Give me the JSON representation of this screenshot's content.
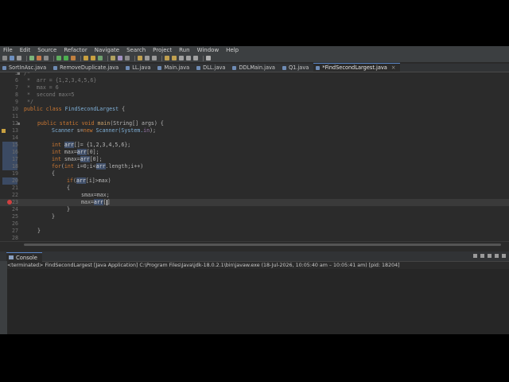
{
  "menu": [
    "File",
    "Edit",
    "Source",
    "Refactor",
    "Navigate",
    "Search",
    "Project",
    "Run",
    "Window",
    "Help"
  ],
  "tabs": [
    {
      "label": "SortInAsc.java"
    },
    {
      "label": "RemoveDuplicate.java"
    },
    {
      "label": "LL.java"
    },
    {
      "label": "Main.java"
    },
    {
      "label": "DLL.java"
    },
    {
      "label": "DDLMain.java"
    },
    {
      "label": "Q1.java"
    },
    {
      "label": "*FindSecondLargest.java",
      "active": true,
      "close": "×"
    }
  ],
  "lines": [
    "5",
    "6",
    "7",
    "8",
    "9",
    "10",
    "11",
    "12",
    "13",
    "14",
    "15",
    "16",
    "17",
    "18",
    "19",
    "20",
    "21",
    "22",
    "23",
    "24",
    "25",
    "26",
    "27",
    "28"
  ],
  "code": {
    "l5": "/*",
    "l6": " *  arr = {1,2,3,4,5,6}",
    "l7": " *  max = 6",
    "l8": " *  second max=5",
    "l9": " */",
    "l10_kw": "public class ",
    "l10_cls": "FindSecondLargest",
    "l10_rest": " {",
    "l12_kw": "public static void ",
    "l12_m": "main",
    "l12_rest": "(String[] args) {",
    "l13_a": "Scanner ",
    "l13_b": "s",
    "l13_c": "=",
    "l13_kw": "new ",
    "l13_d": "Scanner(System.",
    "l13_e": "in",
    "l13_f": ");",
    "l15": "int ",
    "l15_v": "arr",
    "l15_r": "[]= {1,2,3,4,5,6};",
    "l16": "int ",
    "l16_v": "max",
    "l16_e": "=",
    "l16_a": "arr",
    "l16_r": "[0];",
    "l17": "int ",
    "l17_v": "smax",
    "l17_e": "=",
    "l17_a": "arr",
    "l17_r": "[0];",
    "l18_kw": "for",
    "l18_a": "(",
    "l18_int": "int ",
    "l18_b": "i=0;i<",
    "l18_arr": "arr",
    "l18_c": ".length;i++)",
    "l19": "{",
    "l20_kw": "if",
    "l20_a": "(",
    "l20_arr": "arr",
    "l20_b": "[i]>max)",
    "l21": "{",
    "l22": "smax=max;",
    "l23_a": "max=",
    "l23_arr": "arr",
    "l23_b": "[",
    "l23_c": "]",
    "l24": "}",
    "l25": "}",
    "l27": "}"
  },
  "console": {
    "tab_label": "Console",
    "status": "<terminated> FindSecondLargest [Java Application] C:\\Program Files\\Java\\jdk-18.0.2.1\\bin\\javaw.exe  (18-Jul-2026, 10:05:40 am – 10:05:41 am) [pid: 18204]"
  },
  "colors": {
    "keyword": "#cc7832",
    "comment": "#7a7a7a",
    "background": "#2b2b2b",
    "accent": "#5a86c8",
    "error_marker": "#d04040"
  }
}
